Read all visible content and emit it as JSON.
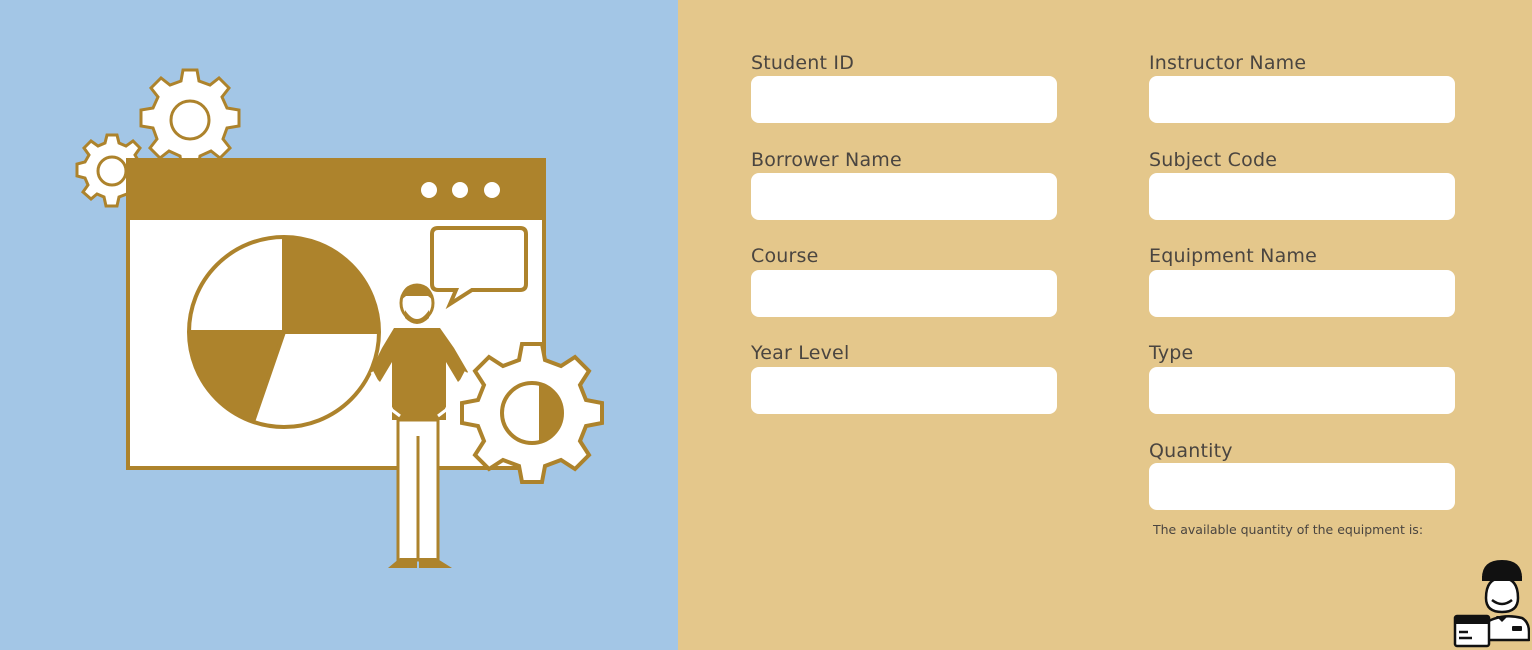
{
  "form": {
    "left_fields": [
      {
        "label": "Student ID",
        "value": ""
      },
      {
        "label": "Borrower Name",
        "value": ""
      },
      {
        "label": "Course",
        "value": ""
      },
      {
        "label": "Year Level",
        "value": ""
      }
    ],
    "right_fields": [
      {
        "label": "Instructor Name",
        "value": ""
      },
      {
        "label": "Subject Code",
        "value": ""
      },
      {
        "label": "Equipment Name",
        "value": ""
      },
      {
        "label": "Type",
        "value": ""
      },
      {
        "label": "Quantity",
        "value": ""
      }
    ],
    "available_quantity_note": "The available quantity of the equipment is:"
  },
  "colors": {
    "left_background": "#a3c6e6",
    "right_background": "#e4c78b",
    "illustration_accent": "#ad832c",
    "input_background": "#ffffff"
  },
  "icons": [
    "gear-icon",
    "browser-window-illustration",
    "pie-chart-icon",
    "speech-bubble-icon",
    "person-illustration",
    "courier-icon"
  ]
}
